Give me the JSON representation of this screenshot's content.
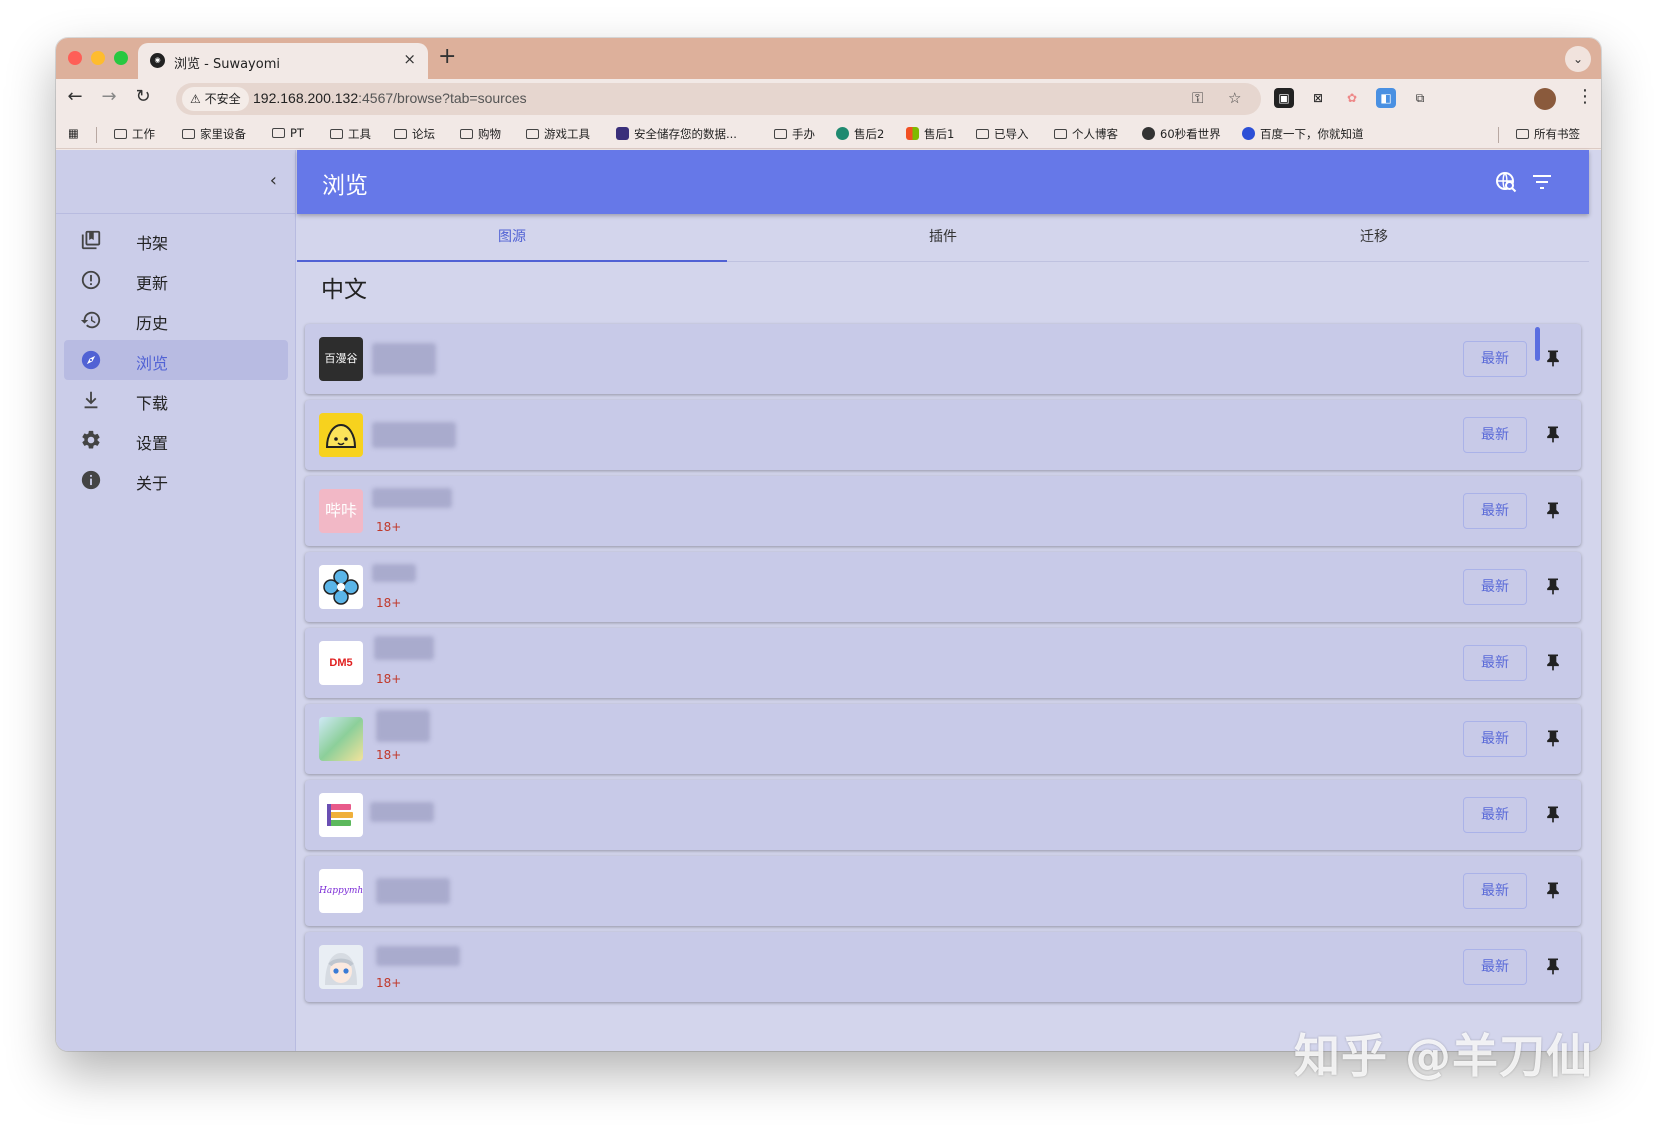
{
  "browser": {
    "tab_title": "浏览 - Suwayomi",
    "tab_favicon": "suwayomi-icon",
    "tab_close": "×",
    "new_tab": "+",
    "insecure_label": "不安全",
    "url_host": "192.168.200.132",
    "url_rest": ":4567/browse?tab=sources",
    "colors": {
      "tabstrip": "#ddb09b",
      "toolbar": "#f2e9e6"
    }
  },
  "bookmarks": {
    "items": [
      "工作",
      "家里设备",
      "PT",
      "工具",
      "论坛",
      "购物",
      "游戏工具",
      "安全储存您的数据...",
      "手办",
      "售后2",
      "售后1",
      "已导入",
      "个人博客",
      "60秒看世界",
      "百度一下，你就知道"
    ],
    "all_bookmarks": "所有书签"
  },
  "sidebar": {
    "items": [
      {
        "label": "书架",
        "icon": "library-icon"
      },
      {
        "label": "更新",
        "icon": "update-icon"
      },
      {
        "label": "历史",
        "icon": "history-icon"
      },
      {
        "label": "浏览",
        "icon": "explore-icon",
        "active": true
      },
      {
        "label": "下载",
        "icon": "download-icon"
      },
      {
        "label": "设置",
        "icon": "settings-icon"
      },
      {
        "label": "关于",
        "icon": "info-icon"
      }
    ]
  },
  "appbar": {
    "title": "浏览",
    "color": "#6678e8"
  },
  "tabs": {
    "items": [
      "图源",
      "插件",
      "迁移"
    ],
    "active": "图源"
  },
  "section_title": "中文",
  "sources": {
    "latest_label": "最新",
    "nsfw_badge": "18+",
    "items": [
      {
        "logo": "百漫谷",
        "nsfw": false
      },
      {
        "logo": "bun-mascot",
        "nsfw": false
      },
      {
        "logo": "哔咔",
        "nsfw": true
      },
      {
        "logo": "clover-logo",
        "nsfw": true
      },
      {
        "logo": "DM5",
        "nsfw": true
      },
      {
        "logo": "colorful-logo",
        "nsfw": true
      },
      {
        "logo": "book-stack-logo",
        "nsfw": false
      },
      {
        "logo": "Happymh",
        "nsfw": false
      },
      {
        "logo": "anime-girl-logo",
        "nsfw": true
      }
    ]
  },
  "watermark": "知乎 @羊刀仙"
}
